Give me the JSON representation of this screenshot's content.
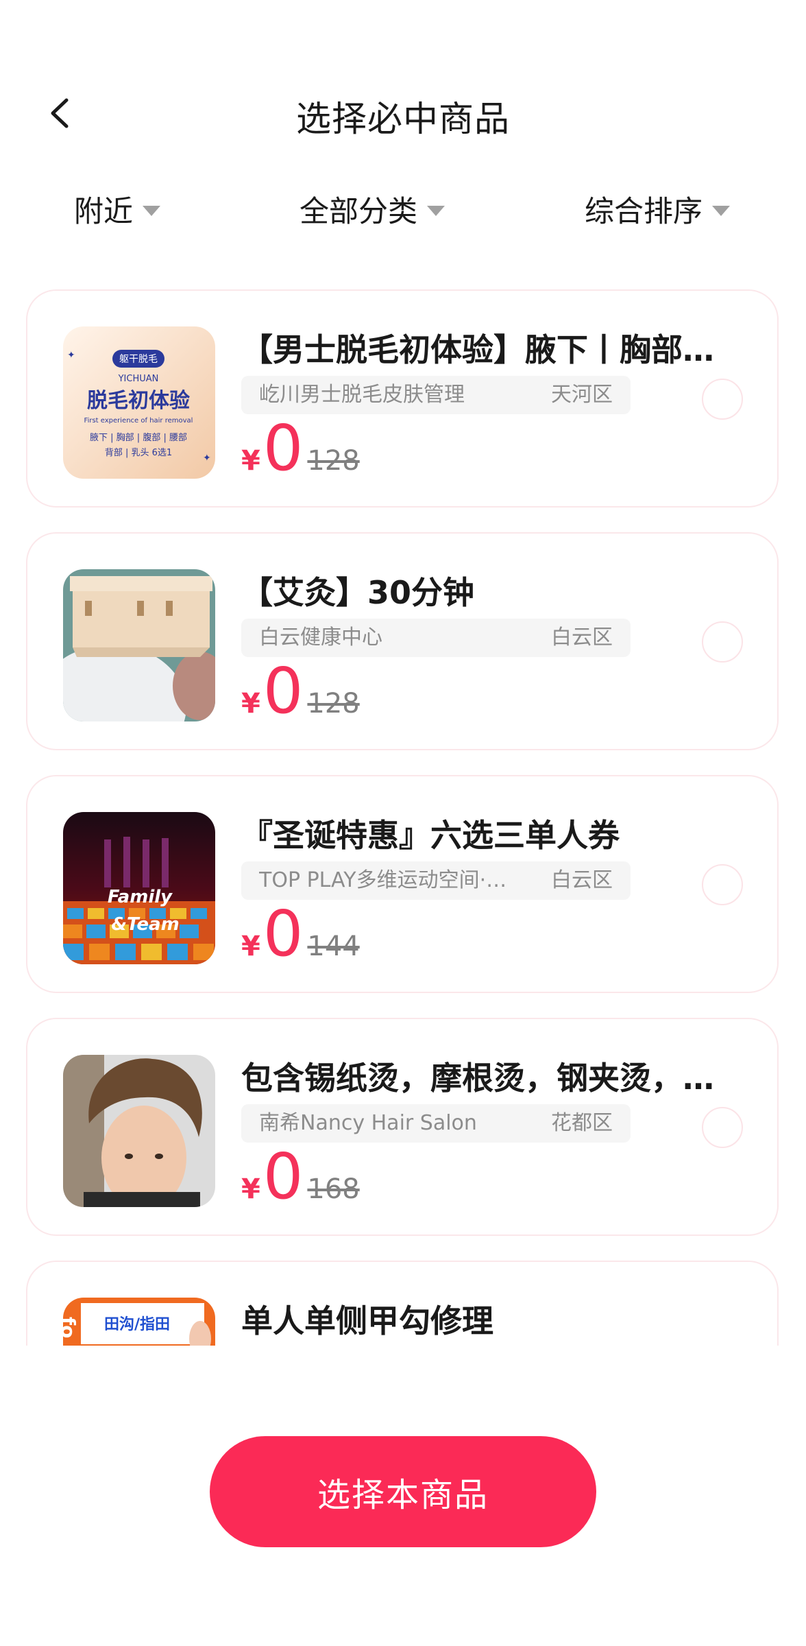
{
  "header": {
    "title": "选择必中商品",
    "back_icon": "chevron-left-icon"
  },
  "filters": [
    {
      "label": "附近",
      "icon": "caret-down-icon"
    },
    {
      "label": "全部分类",
      "icon": "caret-down-icon"
    },
    {
      "label": "综合排序",
      "icon": "caret-down-icon"
    }
  ],
  "currency_symbol": "¥",
  "products": [
    {
      "title": "【男士脱毛初体验】腋下丨胸部丨腹部丨背部丨乳头",
      "shop": "屹川男士脱毛皮肤管理",
      "district": "天河区",
      "price": "0",
      "original_price": "128",
      "thumb": {
        "badge": "躯干脱毛",
        "brand": "YICHUAN",
        "headline": "脱毛初体验",
        "subline": "First experience of hair removal",
        "line1": "腋下 | 胸部 | 腹部 | 腰部",
        "line2": "背部 | 乳头 6选1"
      }
    },
    {
      "title": "【艾灸】30分钟",
      "shop": "白云健康中心",
      "district": "白云区",
      "price": "0",
      "original_price": "128"
    },
    {
      "title": "『圣诞特惠』六选三单人券",
      "shop": "TOP PLAY多维运动空间·白云店",
      "district": "白云区",
      "price": "0",
      "original_price": "144",
      "thumb": {
        "text1": "Family",
        "text2": "&Team"
      }
    },
    {
      "title": "包含锡纸烫，摩根烫，钢夹烫，纹理烫",
      "shop": "南希Nancy Hair Salon",
      "district": "花都区",
      "price": "0",
      "original_price": "168"
    },
    {
      "title": "单人单侧甲勾修理",
      "thumb": {
        "text1": "田沟/指田",
        "text2": "fo"
      }
    }
  ],
  "action_button": {
    "label": "选择本商品"
  },
  "colors": {
    "accent": "#fb2a56",
    "price": "#f4315a",
    "card_border": "#fbe7ea"
  }
}
